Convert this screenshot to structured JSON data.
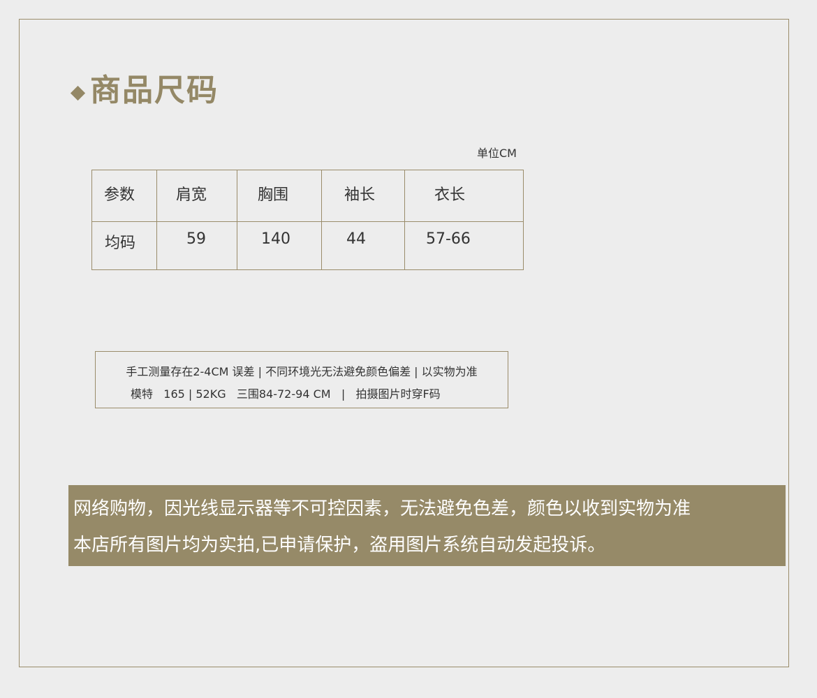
{
  "title": "商品尺码",
  "unit_label": "单位CM",
  "size_table": {
    "headers": [
      "参数",
      "肩宽",
      "胸围",
      "袖长",
      "衣长"
    ],
    "rows": [
      [
        "均码",
        "59",
        "140",
        "44",
        "57-66"
      ]
    ]
  },
  "note": {
    "line1": "手工测量存在2-4CM 误差 | 不同环境光无法避免颜色偏差 | 以实物为准",
    "line2": "模特   165 | 52KG   三围84-72-94 CM   |   拍摄图片时穿F码"
  },
  "banner": {
    "line1": "网络购物，因光线显示器等不可控因素，无法避免色差，颜色以收到实物为准",
    "line2": "本店所有图片均为实拍,已申请保护，盗用图片系统自动发起投诉。"
  },
  "colors": {
    "accent": "#948866",
    "border": "#9a8c6a",
    "banner_bg": "#968a68",
    "background": "#ededed"
  }
}
